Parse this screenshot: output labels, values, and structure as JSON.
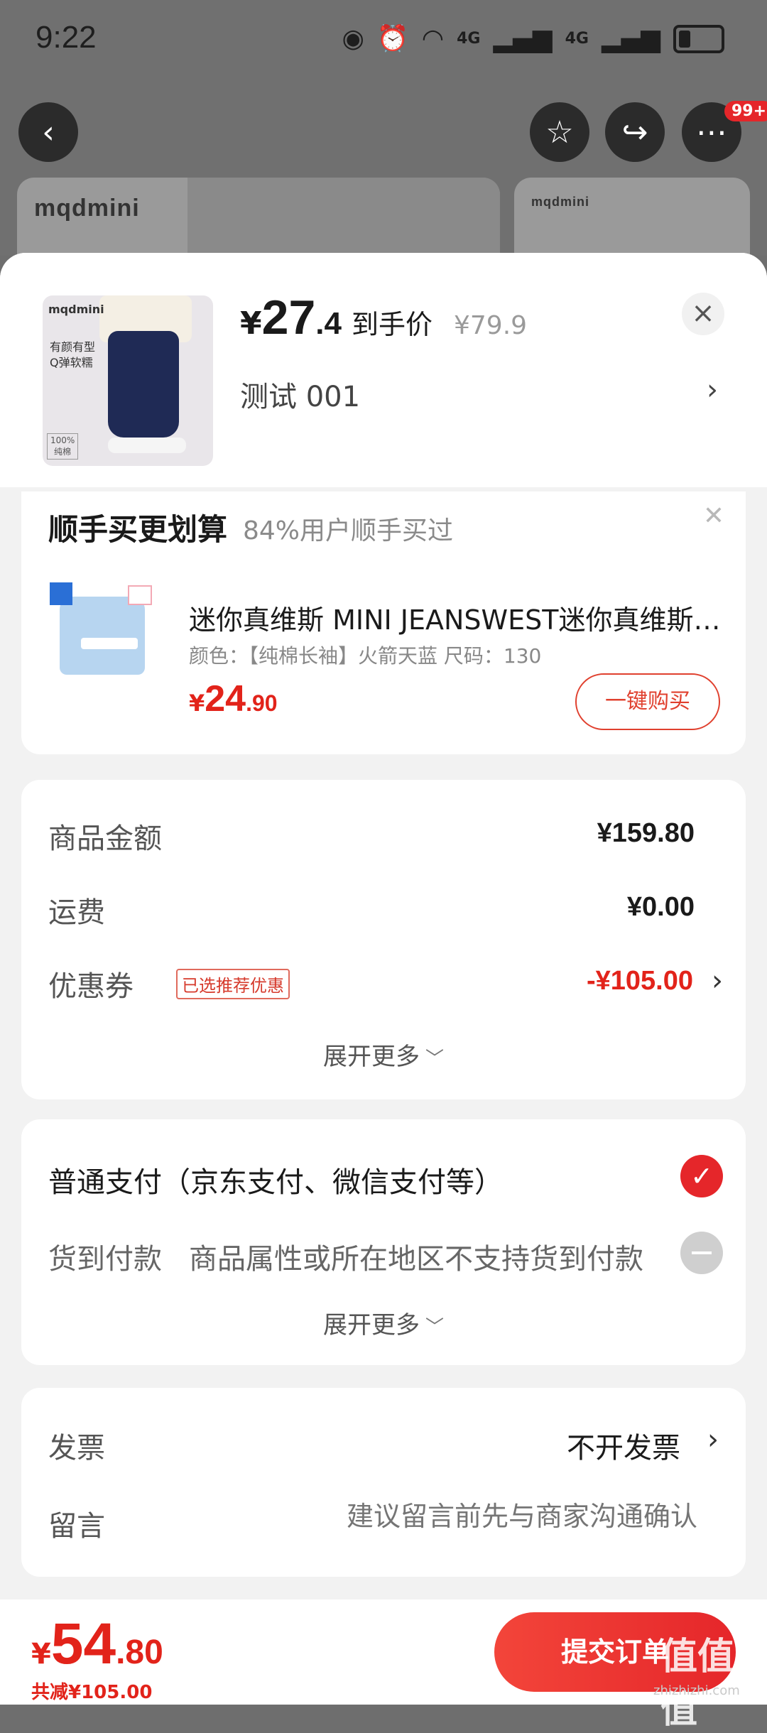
{
  "status_bar": {
    "time": "9:22",
    "net1": "4G",
    "net2": "4G"
  },
  "background": {
    "brand_left": "mqdmini",
    "brand_right": "mqdmini",
    "badge": "99+"
  },
  "product": {
    "price_yen": "¥",
    "price_int": "27",
    "price_dec": ".4",
    "price_label": "到手价",
    "original_price": "¥79.9",
    "spec": "测试  001",
    "thumb_brand": "mqdmini",
    "thumb_text": "有颜有型 Q弹软糯",
    "thumb_tag": "100% 纯棉"
  },
  "recommend": {
    "title": "顺手买更划算",
    "subtitle": "84%用户顺手买过",
    "item_name": "迷你真维斯 MINI JEANSWEST迷你真维斯童装",
    "item_attrs": "颜色：【纯棉长袖】火箭天蓝   尺码：130",
    "price_yen": "¥",
    "price_int": "24",
    "price_dec": ".90",
    "buy_label": "一键购买"
  },
  "summary": {
    "goods_label": "商品金额",
    "goods_value": "¥159.80",
    "shipping_label": "运费",
    "shipping_value": "¥0.00",
    "coupon_label": "优惠券",
    "coupon_badge": "已选推荐优惠",
    "coupon_value": "-¥105.00",
    "expand_label": "展开更多"
  },
  "payment": {
    "normal_label": "普通支付（京东支付、微信支付等）",
    "cod_label": "货到付款",
    "cod_desc": "商品属性或所在地区不支持货到付款",
    "expand_label": "展开更多"
  },
  "extra": {
    "invoice_label": "发票",
    "invoice_value": "不开发票",
    "note_label": "留言",
    "note_placeholder": "建议留言前先与商家沟通确认"
  },
  "footer": {
    "total_yen": "¥",
    "total_int": "54",
    "total_dec": ".80",
    "saved": "共减¥105.00",
    "submit_label": "提交订单"
  },
  "watermark": {
    "main": "值值值",
    "sub": "zhizhizhi.com"
  },
  "colors": {
    "accent_red": "#e5262a",
    "price_red": "#e2231a"
  }
}
